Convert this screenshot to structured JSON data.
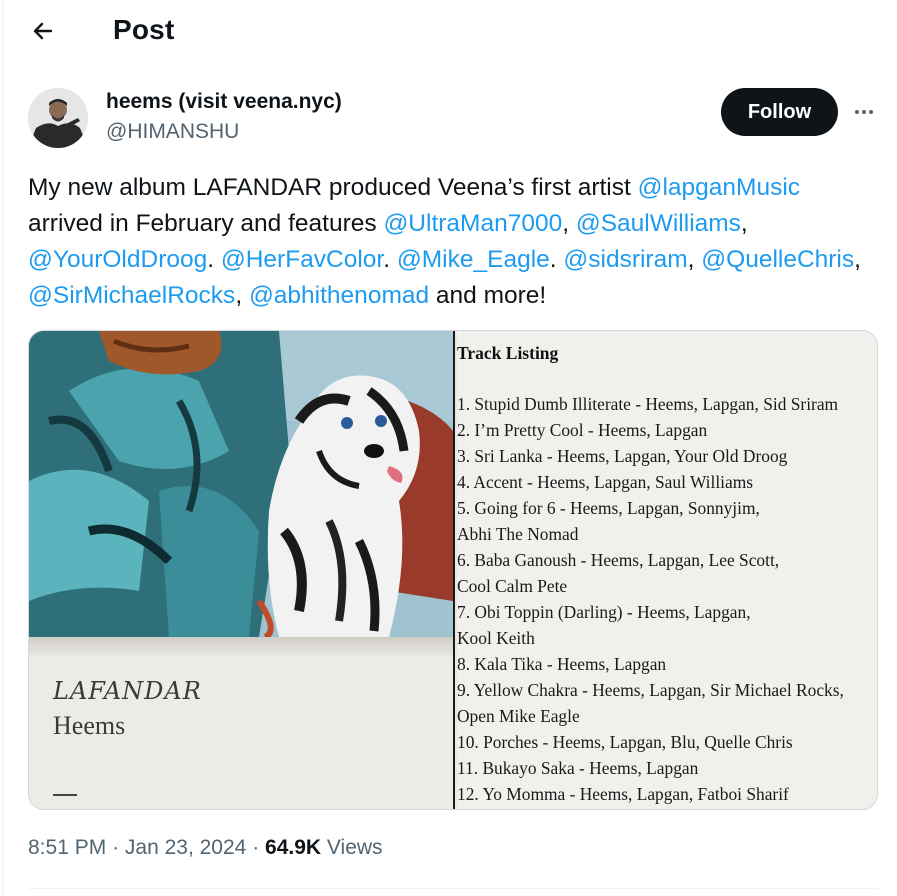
{
  "header": {
    "title": "Post",
    "back_icon": "arrow-left-icon"
  },
  "author": {
    "display_name": "heems (visit veena.nyc)",
    "handle": "@HIMANSHU",
    "avatar_icon": "avatar"
  },
  "actions": {
    "follow_label": "Follow",
    "more_icon": "more-horizontal-icon"
  },
  "tweet": {
    "segments": [
      {
        "text": "My new album LAFANDAR produced Veena’s first artist ",
        "mention": false
      },
      {
        "text": "@lapganMusic",
        "mention": true
      },
      {
        "text": " arrived in February and features ",
        "mention": false
      },
      {
        "text": "@UltraMan7000",
        "mention": true
      },
      {
        "text": ", ",
        "mention": false
      },
      {
        "text": "@SaulWilliams",
        "mention": true
      },
      {
        "text": ", ",
        "mention": false
      },
      {
        "text": "@YourOldDroog",
        "mention": true
      },
      {
        "text": ". ",
        "mention": false
      },
      {
        "text": "@HerFavColor",
        "mention": true
      },
      {
        "text": ". ",
        "mention": false
      },
      {
        "text": "@Mike_Eagle",
        "mention": true
      },
      {
        "text": ". ",
        "mention": false
      },
      {
        "text": "@sidsriram",
        "mention": true
      },
      {
        "text": ", ",
        "mention": false
      },
      {
        "text": "@QuelleChris",
        "mention": true
      },
      {
        "text": ", ",
        "mention": false
      },
      {
        "text": "@SirMichaelRocks",
        "mention": true
      },
      {
        "text": ", ",
        "mention": false
      },
      {
        "text": "@abhithenomad",
        "mention": true
      },
      {
        "text": " and more!",
        "mention": false
      }
    ]
  },
  "media": {
    "album_title": "LAFANDAR",
    "album_artist": "Heems",
    "tracklist_heading": "Track Listing",
    "track_lines": [
      "1. Stupid Dumb Illiterate - Heems, Lapgan, Sid Sriram",
      "2. I’m Pretty Cool - Heems, Lapgan",
      "3. Sri Lanka - Heems, Lapgan, Your Old Droog",
      "4. Accent - Heems, Lapgan, Saul Williams",
      "5. Going for 6 - Heems, Lapgan, Sonnyjim,",
      "Abhi The Nomad",
      "6. Baba Ganoush - Heems, Lapgan, Lee Scott,",
      "Cool Calm Pete",
      "7. Obi Toppin (Darling) - Heems, Lapgan,",
      "Kool Keith",
      "8. Kala Tika - Heems, Lapgan",
      "9. Yellow Chakra - Heems, Lapgan, Sir Michael Rocks,",
      "Open Mike Eagle",
      "10. Porches - Heems, Lapgan, Blu, Quelle Chris",
      "11. Bukayo Saka - Heems, Lapgan",
      "12. Yo Momma - Heems, Lapgan, Fatboi Sharif"
    ]
  },
  "meta": {
    "time": "8:51 PM",
    "separator": "·",
    "date": "Jan 23, 2024",
    "views_count": "64.9K",
    "views_label": "Views"
  },
  "colors": {
    "link": "#1d9bf0",
    "text": "#0f1419",
    "muted": "#536471",
    "button": "#0f1419"
  }
}
